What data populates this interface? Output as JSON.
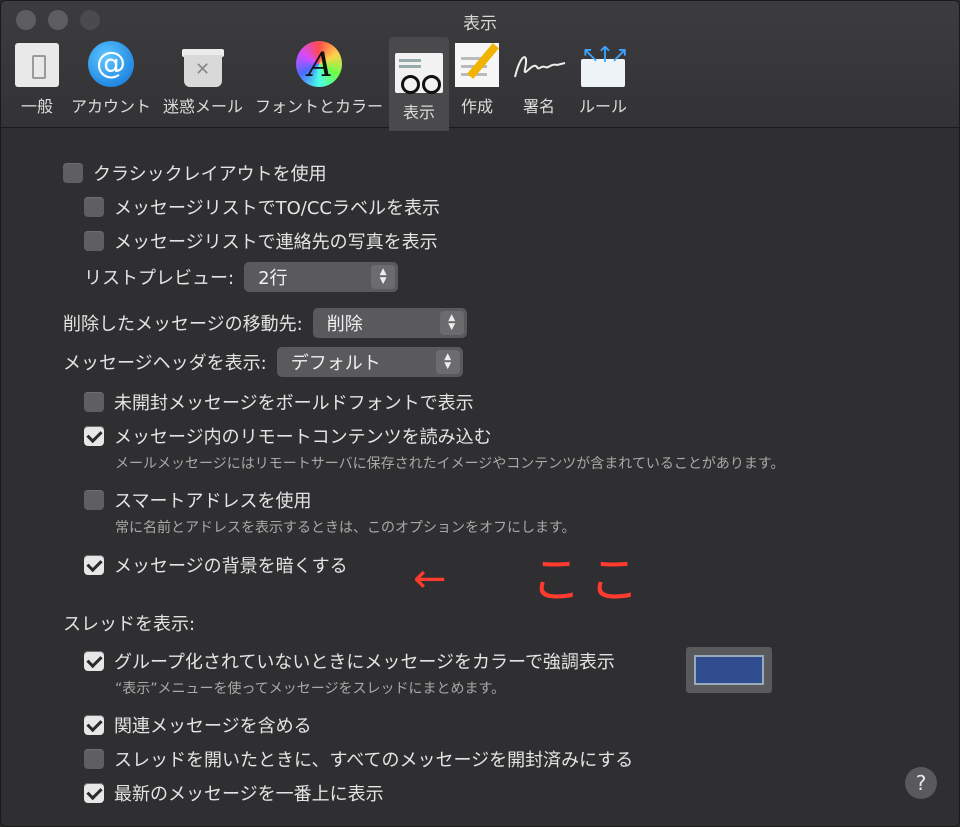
{
  "window": {
    "title": "表示"
  },
  "toolbar": [
    {
      "label": "一般",
      "icon": "general-icon"
    },
    {
      "label": "アカウント",
      "icon": "account-icon"
    },
    {
      "label": "迷惑メール",
      "icon": "junk-mail-icon"
    },
    {
      "label": "フォントとカラー",
      "icon": "fonts-colors-icon"
    },
    {
      "label": "表示",
      "icon": "viewing-icon",
      "selected": true
    },
    {
      "label": "作成",
      "icon": "composing-icon"
    },
    {
      "label": "署名",
      "icon": "signature-icon"
    },
    {
      "label": "ルール",
      "icon": "rules-icon"
    }
  ],
  "settings": {
    "classic_layout": {
      "label": "クラシックレイアウトを使用",
      "checked": false
    },
    "to_cc_labels": {
      "label": "メッセージリストでTO/CCラベルを表示",
      "checked": false
    },
    "contact_photos": {
      "label": "メッセージリストで連絡先の写真を表示",
      "checked": false
    },
    "list_preview": {
      "label": "リストプレビュー:",
      "value": "2行"
    },
    "move_deleted": {
      "label": "削除したメッセージの移動先:",
      "value": "削除"
    },
    "show_header": {
      "label": "メッセージヘッダを表示:",
      "value": "デフォルト"
    },
    "bold_unread": {
      "label": "未開封メッセージをボールドフォントで表示",
      "checked": false
    },
    "remote_content": {
      "label": "メッセージ内のリモートコンテンツを読み込む",
      "checked": true,
      "description": "メールメッセージにはリモートサーバに保存されたイメージやコンテンツが含まれていることがあります。"
    },
    "smart_address": {
      "label": "スマートアドレスを使用",
      "checked": false,
      "description": "常に名前とアドレスを表示するときは、このオプションをオフにします。"
    },
    "dark_background": {
      "label": "メッセージの背景を暗くする",
      "checked": true
    },
    "threads_heading": "スレッドを表示:",
    "highlight_threads": {
      "label": "グループ化されていないときにメッセージをカラーで強調表示",
      "checked": true,
      "description": "“表示”メニューを使ってメッセージをスレッドにまとめます。",
      "color": "#2f4d8f"
    },
    "include_related": {
      "label": "関連メッセージを含める",
      "checked": true
    },
    "mark_all_read": {
      "label": "スレッドを開いたときに、すべてのメッセージを開封済みにする",
      "checked": false
    },
    "newest_top": {
      "label": "最新のメッセージを一番上に表示",
      "checked": true
    }
  },
  "annotation": {
    "arrow": "←",
    "text": "ここ",
    "color": "#ff3b30"
  },
  "help": "?"
}
